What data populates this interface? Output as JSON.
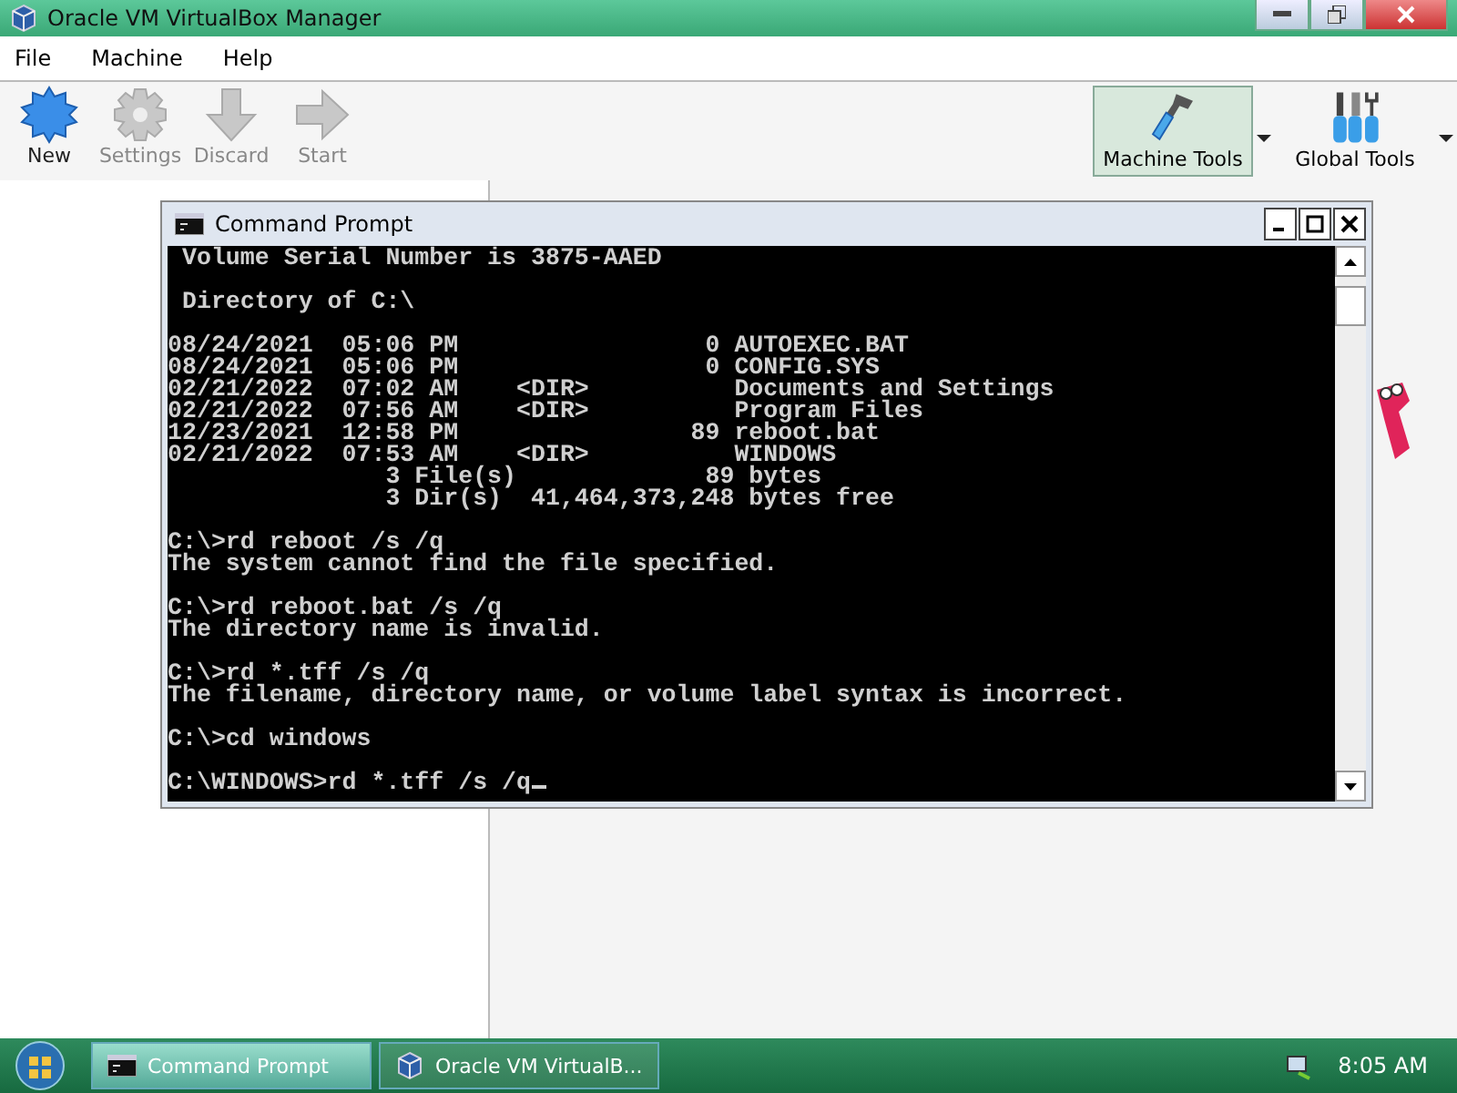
{
  "window": {
    "title": "Oracle VM VirtualBox Manager"
  },
  "menu": [
    "File",
    "Machine",
    "Help"
  ],
  "toolbar": [
    {
      "label": "New",
      "kind": "new",
      "disabled": false
    },
    {
      "label": "Settings",
      "kind": "settings",
      "disabled": true
    },
    {
      "label": "Discard",
      "kind": "discard",
      "disabled": true
    },
    {
      "label": "Start",
      "kind": "start",
      "disabled": true
    }
  ],
  "tools": [
    {
      "label": "Machine Tools",
      "kind": "machine",
      "selected": true
    },
    {
      "label": "Global Tools",
      "kind": "global",
      "selected": false
    }
  ],
  "console": {
    "title": "Command Prompt",
    "blocks": [
      [
        " Volume Serial Number is 3875-AAED"
      ],
      [
        " Directory of C:\\"
      ],
      [
        "08/24/2021  05:06 PM                 0 AUTOEXEC.BAT",
        "08/24/2021  05:06 PM                 0 CONFIG.SYS",
        "02/21/2022  07:02 AM    <DIR>          Documents and Settings",
        "02/21/2022  07:56 AM    <DIR>          Program Files",
        "12/23/2021  12:58 PM                89 reboot.bat",
        "02/21/2022  07:53 AM    <DIR>          WINDOWS",
        "               3 File(s)             89 bytes",
        "               3 Dir(s)  41,464,373,248 bytes free"
      ],
      [
        "C:\\>rd reboot /s /q",
        "The system cannot find the file specified."
      ],
      [
        "C:\\>rd reboot.bat /s /q",
        "The directory name is invalid."
      ],
      [
        "C:\\>rd *.tff /s /q",
        "The filename, directory name, or volume label syntax is incorrect."
      ],
      [
        "C:\\>cd windows"
      ],
      [
        "C:\\WINDOWS>rd *.tff /s /q"
      ]
    ]
  },
  "taskbar": {
    "tasks": [
      {
        "label": "Command Prompt",
        "kind": "console",
        "selected": true
      },
      {
        "label": "Oracle VM VirtualB...",
        "kind": "vbox",
        "selected": false
      }
    ],
    "clock": "8:05 AM"
  }
}
